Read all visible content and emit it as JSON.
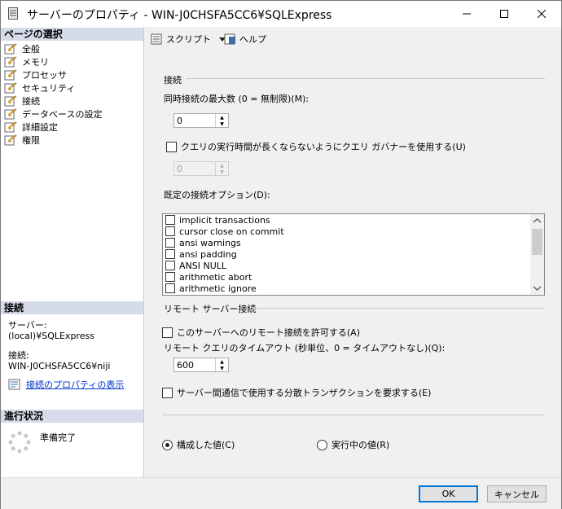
{
  "window": {
    "title": "サーバーのプロパティ - WIN-J0CHSFA5CC6¥SQLExpress"
  },
  "left": {
    "pages_header": "ページの選択",
    "pages": [
      {
        "label": "全般"
      },
      {
        "label": "メモリ"
      },
      {
        "label": "プロセッサ"
      },
      {
        "label": "セキュリティ"
      },
      {
        "label": "接続"
      },
      {
        "label": "データベースの設定"
      },
      {
        "label": "詳細設定"
      },
      {
        "label": "権限"
      }
    ],
    "connection_header": "接続",
    "server_label": "サーバー:",
    "server_value": "(local)¥SQLExpress",
    "conn_label": "接続:",
    "conn_value": "WIN-J0CHSFA5CC6¥niji",
    "conn_props_link": "接続のプロパティの表示",
    "progress_header": "進行状況",
    "progress_status": "準備完了"
  },
  "toolbar": {
    "script_label": "スクリプト",
    "help_label": "ヘルプ"
  },
  "main": {
    "connections_group": "接続",
    "max_conn_label": "同時接続の最大数 (0 = 無制限)(M):",
    "max_conn_value": "0",
    "query_governor_label": "クエリの実行時間が長くならないようにクエリ ガバナーを使用する(U)",
    "query_governor_value": "0",
    "default_options_label": "既定の接続オプション(D):",
    "default_options": [
      {
        "label": "implicit transactions"
      },
      {
        "label": "cursor close on commit"
      },
      {
        "label": "ansi warnings"
      },
      {
        "label": "ansi padding"
      },
      {
        "label": "ANSI NULL"
      },
      {
        "label": "arithmetic abort"
      },
      {
        "label": "arithmetic ignore"
      }
    ],
    "remote_group": "リモート サーバー接続",
    "allow_remote_label": "このサーバーへのリモート接続を許可する(A)",
    "remote_timeout_label": "リモート クエリのタイムアウト (秒単位、0 = タイムアウトなし)(Q):",
    "remote_timeout_value": "600",
    "distributed_tx_label": "サーバー間通信で使用する分散トランザクションを要求する(E)",
    "configured_label": "構成した値(C)",
    "running_label": "実行中の値(R)"
  },
  "buttons": {
    "ok": "OK",
    "cancel": "キャンセル"
  }
}
